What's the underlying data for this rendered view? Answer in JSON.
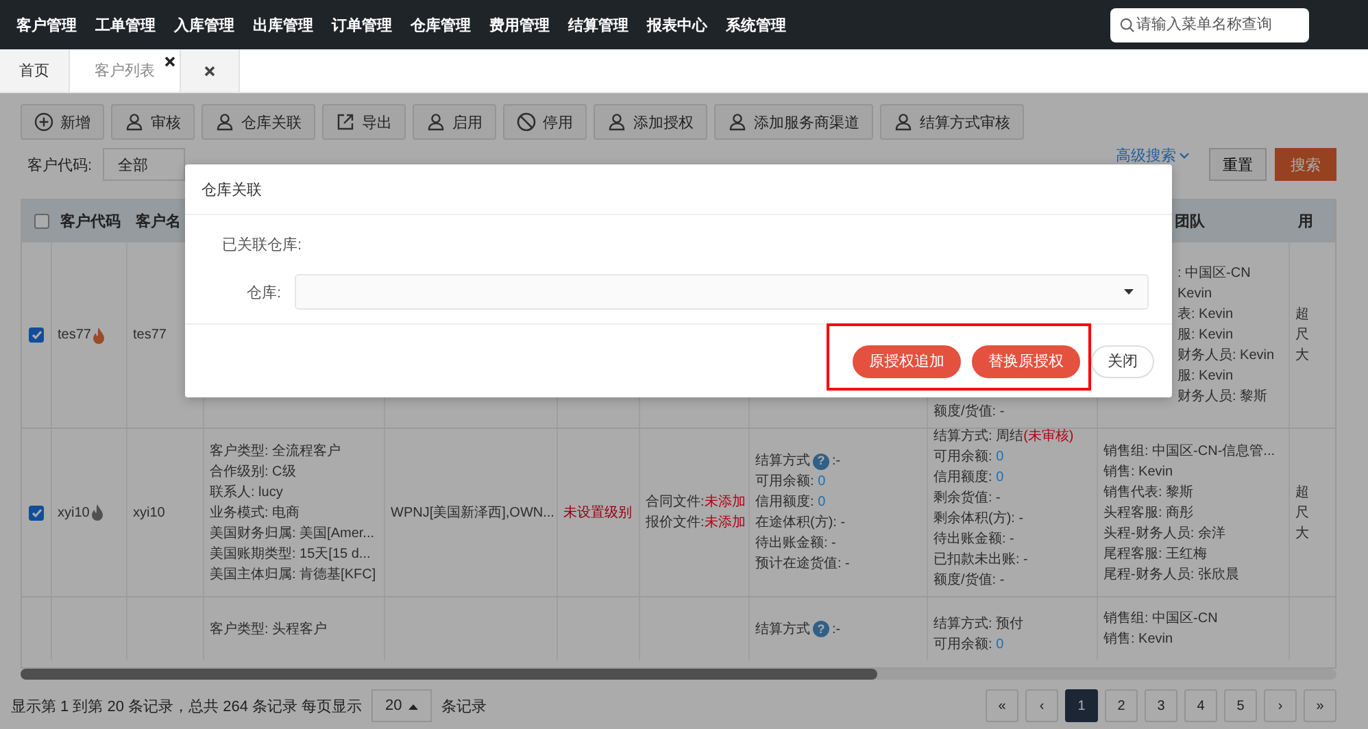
{
  "top_nav": {
    "menu": [
      "客户管理",
      "工单管理",
      "入库管理",
      "出库管理",
      "订单管理",
      "仓库管理",
      "费用管理",
      "结算管理",
      "报表中心",
      "系统管理"
    ],
    "search": {
      "placeholder": "请输入菜单名称查询"
    }
  },
  "tabs": [
    {
      "label": "首页",
      "selected": false,
      "closable": false
    },
    {
      "label": "客户列表",
      "selected": true,
      "closable": true
    }
  ],
  "toolbar": [
    {
      "label": "新增",
      "kind": "add"
    },
    {
      "label": "审核",
      "kind": "user"
    },
    {
      "label": "仓库关联",
      "kind": "user"
    },
    {
      "label": "导出",
      "kind": "export"
    },
    {
      "label": "启用",
      "kind": "user"
    },
    {
      "label": "停用",
      "kind": "ban"
    },
    {
      "label": "添加授权",
      "kind": "user"
    },
    {
      "label": "添加服务商渠道",
      "kind": "user"
    },
    {
      "label": "结算方式审核",
      "kind": "user"
    }
  ],
  "filters": {
    "customer_code": {
      "label": "客户代码:",
      "value": "全部"
    },
    "advanced_search": "高级搜索",
    "reset": "重置",
    "search": "搜索"
  },
  "table": {
    "select_all": {
      "checked": false
    },
    "columns": [
      "客户代码",
      "客户名",
      "团队",
      "用"
    ],
    "rows": [
      {
        "checked": true,
        "code": "tes77",
        "hot": true,
        "name": "tes77",
        "account": [
          {
            "label": "额度/货值: -"
          }
        ],
        "team": [
          {
            "label": ": 中国区-CN"
          },
          {
            "label": "Kevin"
          },
          {
            "label": "表: Kevin"
          },
          {
            "label": "服: Kevin"
          },
          {
            "label": "财务人员: Kevin"
          },
          {
            "label": "服: Kevin"
          },
          {
            "label": "财务人员: 黎斯"
          }
        ],
        "extra": [
          {
            "label": "超"
          },
          {
            "label": "尺"
          },
          {
            "label": "大"
          }
        ]
      },
      {
        "checked": true,
        "code": "xyi10",
        "hot": false,
        "name": "xyi10",
        "profile": [
          {
            "label": "客户类型: 全流程客户"
          },
          {
            "label": "合作级别: C级"
          },
          {
            "label": "联系人: lucy"
          },
          {
            "label": "业务模式: 电商"
          },
          {
            "label": "美国财务归属: 美国[Amer..."
          },
          {
            "label": "美国账期类型: 15天[15 d..."
          },
          {
            "label": "美国主体归属: 肯德基[KFC]"
          }
        ],
        "warehouse": "WPNJ[美国新泽西],OWN...",
        "level": "未设置级别",
        "files": [
          {
            "label": "合同文件:",
            "value": "未添加",
            "color": "#b00012"
          },
          {
            "label": "报价文件:",
            "value": "未添加",
            "color": "#b00012"
          }
        ],
        "settlement": [
          {
            "label": "结算方式",
            "help": "?",
            "value": ":-"
          },
          {
            "label": "可用余额: ",
            "value": "0",
            "color": "#1670b8"
          },
          {
            "label": "信用额度: ",
            "value": "0",
            "color": "#1670b8"
          },
          {
            "label": "在途体积(方): -"
          },
          {
            "label": "待出账金额: -"
          },
          {
            "label": "预计在途货值: -"
          }
        ],
        "account": [
          {
            "label": "结算方式: 周结",
            "value": "(未审核)",
            "color": "#b00012"
          },
          {
            "label": "可用余额: ",
            "value": "0",
            "color": "#1670b8"
          },
          {
            "label": "信用额度: ",
            "value": "0",
            "color": "#1670b8"
          },
          {
            "label": "剩余货值: -"
          },
          {
            "label": "剩余体积(方): -"
          },
          {
            "label": "待出账金额: -"
          },
          {
            "label": "已扣款未出账: -"
          },
          {
            "label": "额度/货值: -"
          }
        ],
        "team": [
          {
            "label": "销售组: 中国区-CN-信息管..."
          },
          {
            "label": "销售: Kevin"
          },
          {
            "label": "销售代表: 黎斯"
          },
          {
            "label": "头程客服: 商彤"
          },
          {
            "label": "头程-财务人员: 余洋"
          },
          {
            "label": "尾程客服: 王红梅"
          },
          {
            "label": "尾程-财务人员: 张欣晨"
          }
        ],
        "extra": [
          {
            "label": "超"
          },
          {
            "label": "尺"
          },
          {
            "label": "大"
          }
        ]
      },
      {
        "profile": [
          {
            "label": "客户类型: 头程客户"
          }
        ],
        "settlement": [
          {
            "label": "结算方式",
            "help": "?",
            "value": ":-"
          }
        ],
        "account": [
          {
            "label": "结算方式: 预付"
          },
          {
            "label": "可用余额: ",
            "value": "0",
            "color": "#1670b8"
          }
        ],
        "team": [
          {
            "label": "销售组: 中国区-CN"
          },
          {
            "label": "销售: Kevin"
          }
        ]
      }
    ]
  },
  "footer": {
    "summary": "显示第 1 到第 20 条记录，总共 264 条记录 每页显示",
    "page_size": "20",
    "suffix": "条记录",
    "pages": [
      {
        "label": "«",
        "selected": false
      },
      {
        "label": "‹",
        "selected": false
      },
      {
        "label": "1",
        "selected": true
      },
      {
        "label": "2",
        "selected": false
      },
      {
        "label": "3",
        "selected": false
      },
      {
        "label": "4",
        "selected": false
      },
      {
        "label": "5",
        "selected": false
      },
      {
        "label": "›",
        "selected": false
      },
      {
        "label": "»",
        "selected": false
      }
    ]
  },
  "dialog": {
    "title": "仓库关联",
    "linked_label": "已关联仓库:",
    "warehouse_label": "仓库:",
    "buttons": [
      {
        "label": "原授权追加",
        "kind": "primary"
      },
      {
        "label": "替换原授权",
        "kind": "primary"
      },
      {
        "label": "关闭",
        "kind": "plain"
      }
    ],
    "highlight": true
  }
}
